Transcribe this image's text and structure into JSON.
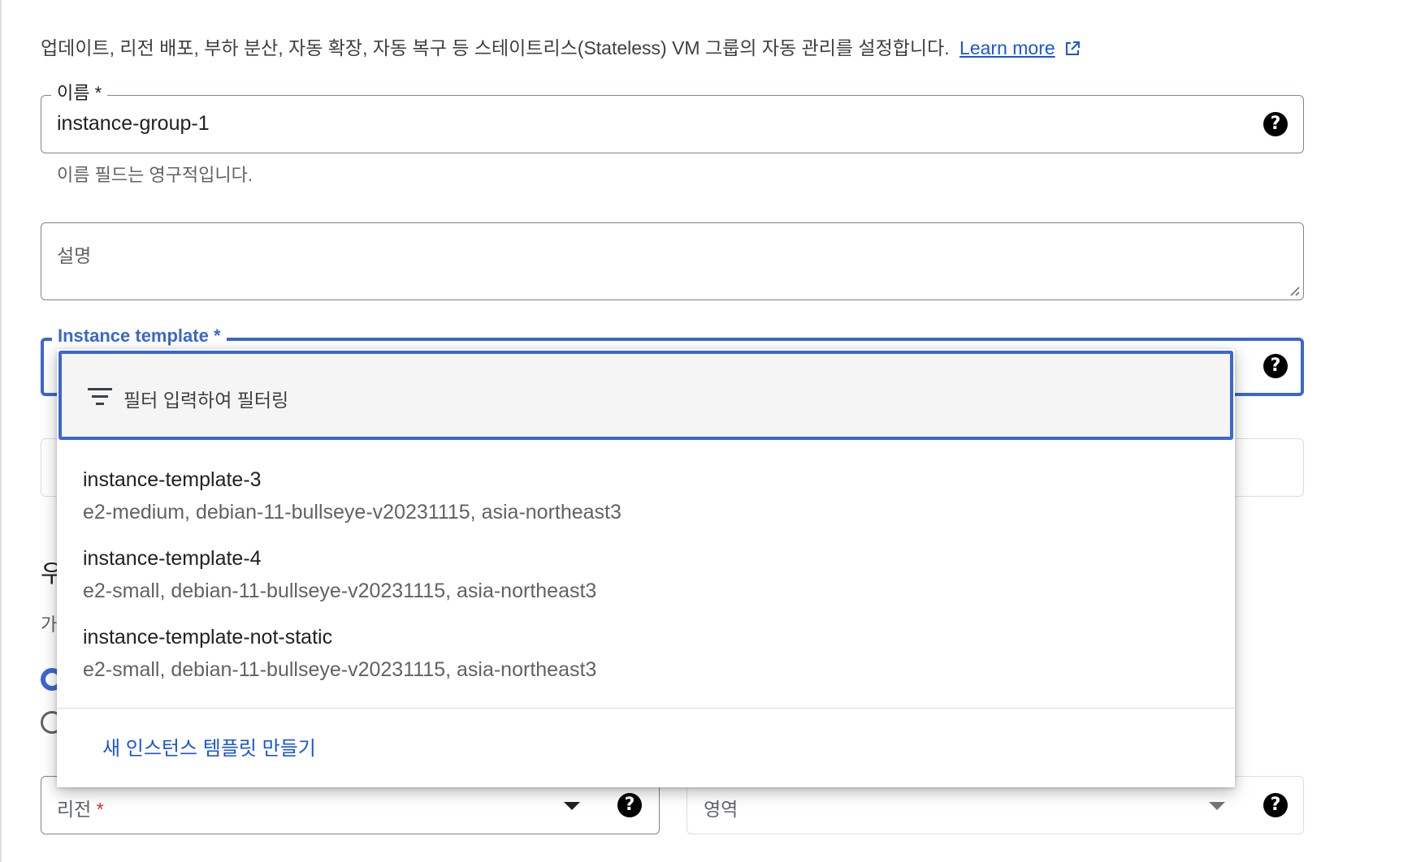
{
  "intro": {
    "text": "업데이트, 리전 배포, 부하 분산, 자동 확장, 자동 복구 등 스테이트리스(Stateless) VM 그룹의 자동 관리를 설정합니다.",
    "learn_more": "Learn more"
  },
  "name_field": {
    "label": "이름 *",
    "value": "instance-group-1",
    "hint": "이름 필드는 영구적입니다."
  },
  "description_field": {
    "placeholder": "설명"
  },
  "template_field": {
    "label": "Instance template *"
  },
  "partial_text": {
    "heading_fragment": "우",
    "sub_fragment": "가"
  },
  "dropdown": {
    "filter_placeholder": "필터 입력하여 필터링",
    "options": [
      {
        "title": "instance-template-3",
        "subtitle": "e2-medium, debian-11-bullseye-v20231115, asia-northeast3"
      },
      {
        "title": "instance-template-4",
        "subtitle": "e2-small, debian-11-bullseye-v20231115, asia-northeast3"
      },
      {
        "title": "instance-template-not-static",
        "subtitle": "e2-small, debian-11-bullseye-v20231115, asia-northeast3"
      }
    ],
    "create_link": "새 인스턴스 템플릿 만들기"
  },
  "region_select": {
    "label": "리전",
    "required_mark": "*"
  },
  "zone_select": {
    "label": "영역"
  },
  "help_glyph": "?",
  "colors": {
    "accent": "#3b67d0",
    "link": "#1a56db",
    "required": "#d93025",
    "border": "#80868b"
  },
  "icons": {
    "help": "help-icon",
    "external_link": "external-link-icon",
    "filter": "filter-icon",
    "dropdown": "chevron-down-icon"
  }
}
